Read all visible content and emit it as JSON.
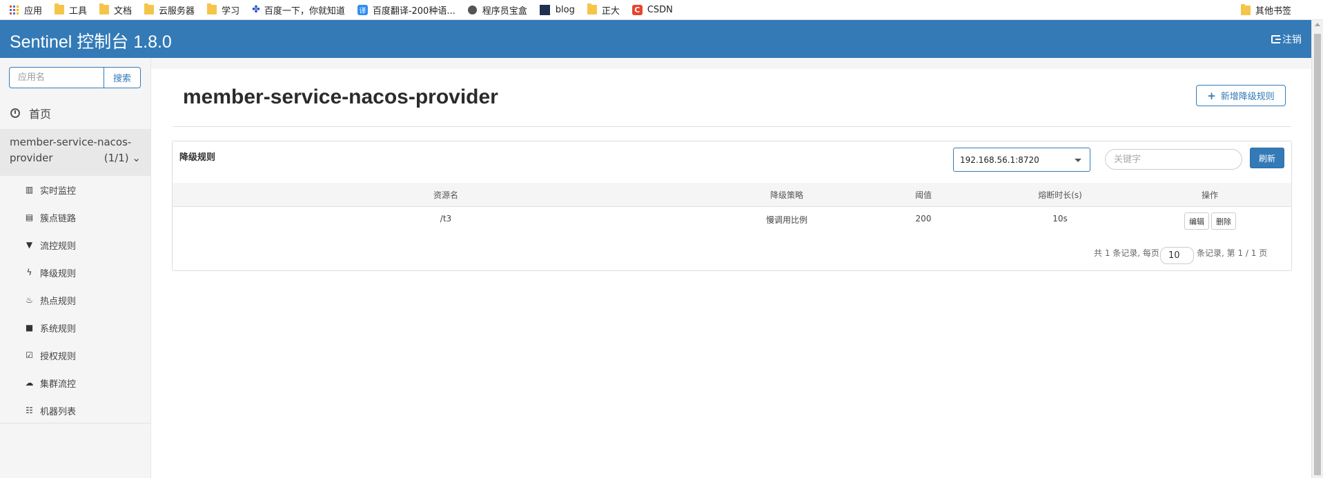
{
  "bookmarks": {
    "items": [
      "应用",
      "工具",
      "文档",
      "云服务器",
      "学习",
      "百度一下，你就知道",
      "百度翻译-200种语...",
      "程序员宝盒",
      "blog",
      "正大",
      "CSDN"
    ],
    "other": "其他书签",
    "trans_glyph": "译",
    "csdn_glyph": "C"
  },
  "header": {
    "brand": "Sentinel 控制台 1.8.0",
    "logout": "注销"
  },
  "sidebar": {
    "search_placeholder": "应用名",
    "search_button": "搜索",
    "home": "首页",
    "app_name_line1": "member-service-nacos-",
    "app_name_line2": "provider",
    "app_count": "(1/1)",
    "items": [
      {
        "label": "实时监控",
        "icon": "bar-chart-icon"
      },
      {
        "label": "簇点链路",
        "icon": "list-icon"
      },
      {
        "label": "流控规则",
        "icon": "filter-icon"
      },
      {
        "label": "降级规则",
        "icon": "flash-icon"
      },
      {
        "label": "热点规则",
        "icon": "fire-icon"
      },
      {
        "label": "系统规则",
        "icon": "lock-icon"
      },
      {
        "label": "授权规则",
        "icon": "check-icon"
      },
      {
        "label": "集群流控",
        "icon": "cloud-icon"
      },
      {
        "label": "机器列表",
        "icon": "th-list-icon"
      }
    ]
  },
  "main": {
    "title": "member-service-nacos-provider",
    "add_button": "新增降级规则",
    "panel_title": "降级规则",
    "machine_select": "192.168.56.1:8720",
    "keyword_placeholder": "关键字",
    "refresh_button": "刷新",
    "table": {
      "headers": [
        "资源名",
        "降级策略",
        "阈值",
        "熔断时长(s)",
        "操作"
      ],
      "rows": [
        {
          "resource": "/t3",
          "strategy": "慢调用比例",
          "threshold": "200",
          "duration": "10s",
          "edit": "编辑",
          "delete": "删除"
        }
      ]
    },
    "pager": {
      "prefix": "共 1 条记录, 每页",
      "page_size": "10",
      "suffix": "条记录, 第 1 / 1 页"
    }
  },
  "colors": {
    "primary": "#337ab7",
    "sidebar_bg": "#f5f5f5"
  }
}
